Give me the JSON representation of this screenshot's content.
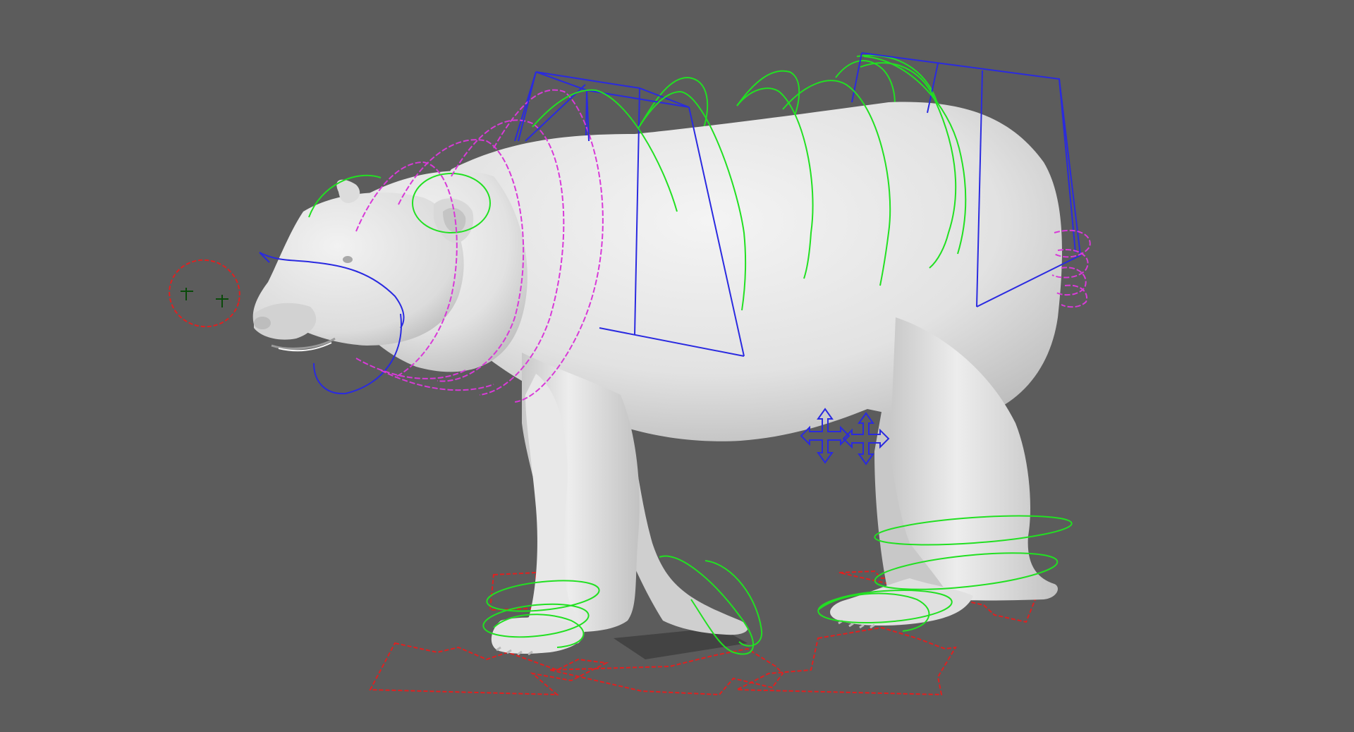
{
  "viewport": {
    "name": "3d-viewport",
    "background_color": "#5c5c5c",
    "subject": "polar-bear-rig",
    "mesh_color": "#e6e6e6"
  },
  "rig_colors": {
    "ik_controls": "#e02020",
    "fk_controls": "#22e022",
    "spine_controls": "#d83ad8",
    "body_controls": "#2a2ae0",
    "mesh": "#e6e6e6"
  },
  "controls": [
    {
      "name": "eye-aim-control",
      "color_key": "ik_controls",
      "icon": "ellipse-with-crosshairs"
    },
    {
      "name": "head-control",
      "color_key": "body_controls",
      "icon": "curve"
    },
    {
      "name": "jaw-control",
      "color_key": "body_controls",
      "icon": "curve"
    },
    {
      "name": "ear-control",
      "color_key": "fk_controls",
      "icon": "ring"
    },
    {
      "name": "neck-controls",
      "color_key": "spine_controls",
      "icon": "rings"
    },
    {
      "name": "chest-control",
      "color_key": "body_controls",
      "icon": "box"
    },
    {
      "name": "hip-control",
      "color_key": "body_controls",
      "icon": "box"
    },
    {
      "name": "spine-fk-controls",
      "color_key": "fk_controls",
      "icon": "arcs"
    },
    {
      "name": "tail-controls",
      "color_key": "spine_controls",
      "icon": "rings"
    },
    {
      "name": "belly-move-controls",
      "color_key": "body_controls",
      "icon": "four-arrow-move"
    },
    {
      "name": "front-foot-ik-controls",
      "color_key": "ik_controls",
      "icon": "arrow-shape"
    },
    {
      "name": "back-foot-ik-controls",
      "color_key": "ik_controls",
      "icon": "arrow-shape"
    },
    {
      "name": "leg-fk-controls",
      "color_key": "fk_controls",
      "icon": "rings"
    }
  ]
}
